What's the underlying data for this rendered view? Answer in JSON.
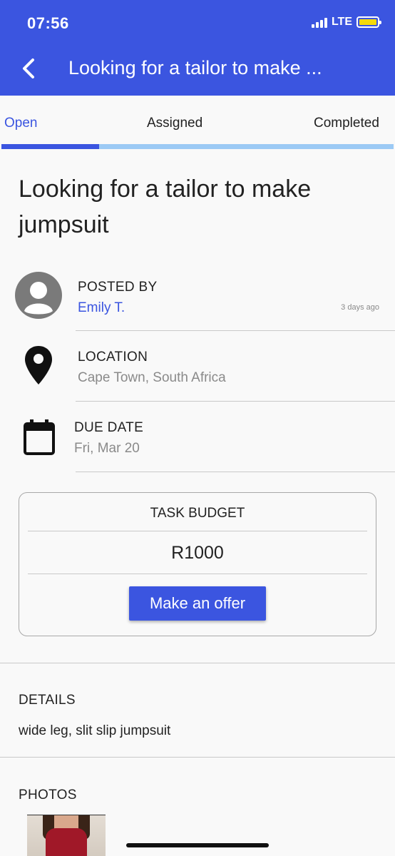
{
  "status_bar": {
    "time": "07:56",
    "network": "LTE",
    "battery_color": "#f5d90a"
  },
  "header": {
    "title": "Looking for a tailor to make ...",
    "back_icon": "chevron-left-icon",
    "background": "#3b55e0"
  },
  "tabs": {
    "items": [
      {
        "label": "Open"
      },
      {
        "label": "Assigned"
      },
      {
        "label": "Completed"
      }
    ],
    "active_index": 0,
    "accent": "#3b55e0",
    "track_color": "#9ccaf5"
  },
  "task": {
    "title": "Looking for a tailor to make jumpsuit"
  },
  "posted_by": {
    "label": "POSTED BY",
    "name": "Emily T.",
    "ago": "3 days ago",
    "icon": "avatar-placeholder-icon"
  },
  "location": {
    "label": "LOCATION",
    "value": "Cape Town, South Africa",
    "icon": "map-pin-icon"
  },
  "due_date": {
    "label": "DUE DATE",
    "value": "Fri, Mar 20",
    "icon": "calendar-icon"
  },
  "budget": {
    "label": "TASK BUDGET",
    "amount": "R1000",
    "button_label": "Make an offer"
  },
  "details": {
    "label": "DETAILS",
    "text": "wide leg, slit slip jumpsuit"
  },
  "photos": {
    "label": "PHOTOS"
  }
}
